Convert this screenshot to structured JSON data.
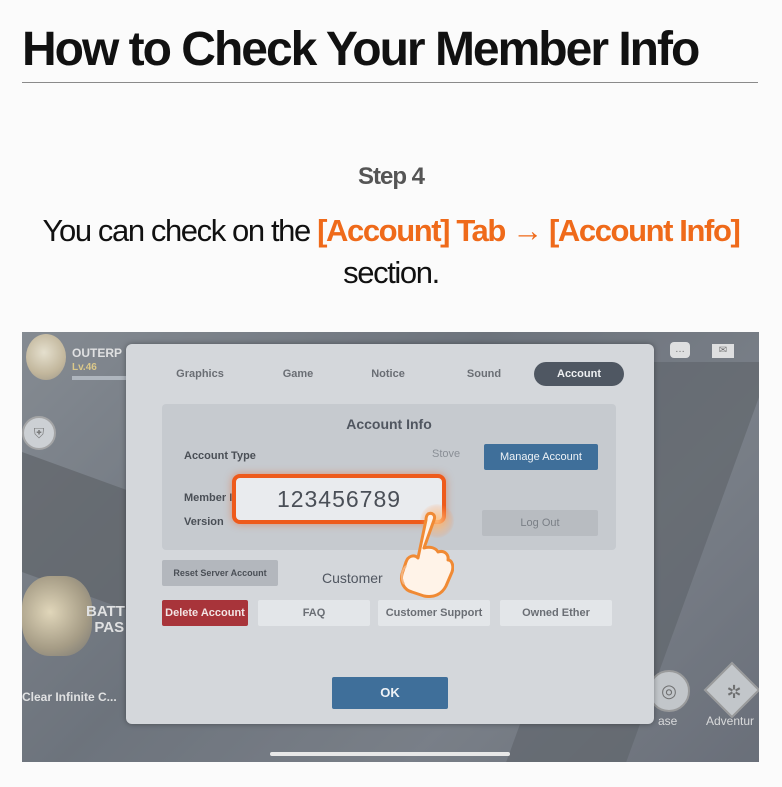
{
  "header": {
    "title": "How to Check Your Member Info"
  },
  "step": {
    "label": "Step 4",
    "text_before": "You can check on the ",
    "highlight": "[Account] Tab → [Account Info]",
    "text_after": "section."
  },
  "colors": {
    "highlight": "#ef6a1a",
    "member_box_border": "#ee5a1b",
    "primary_button": "#3f6f9a",
    "danger_button": "#a8343a"
  },
  "game": {
    "hud": {
      "player_name": "OUTERP",
      "level": "Lv.46",
      "battle_pass_line1": "BATT",
      "battle_pass_line2": "PAS",
      "quest": "Clear Infinite C...",
      "base_label": "ase",
      "adventure_label": "Adventur"
    },
    "settings": {
      "tabs": [
        "Graphics",
        "Game",
        "Notice",
        "Sound",
        "Account"
      ],
      "active_tab": "Account",
      "account_info": {
        "title": "Account Info",
        "account_type_label": "Account Type",
        "account_type_value": "Stove",
        "manage_button": "Manage Account",
        "member_info_label": "Member Info",
        "member_info_value": "123456789",
        "version_label": "Version",
        "logout_button": "Log Out"
      },
      "reset_button": "Reset Server Account",
      "customer_service": {
        "title_left": "Customer",
        "title_right": "t",
        "buttons": [
          "Delete Account",
          "FAQ",
          "Customer Support",
          "Owned Ether"
        ]
      },
      "ok_button": "OK"
    }
  },
  "icons": [
    "shield-icon",
    "chat-icon",
    "mail-icon",
    "base-icon",
    "adventure-icon",
    "pointing-hand-icon"
  ]
}
